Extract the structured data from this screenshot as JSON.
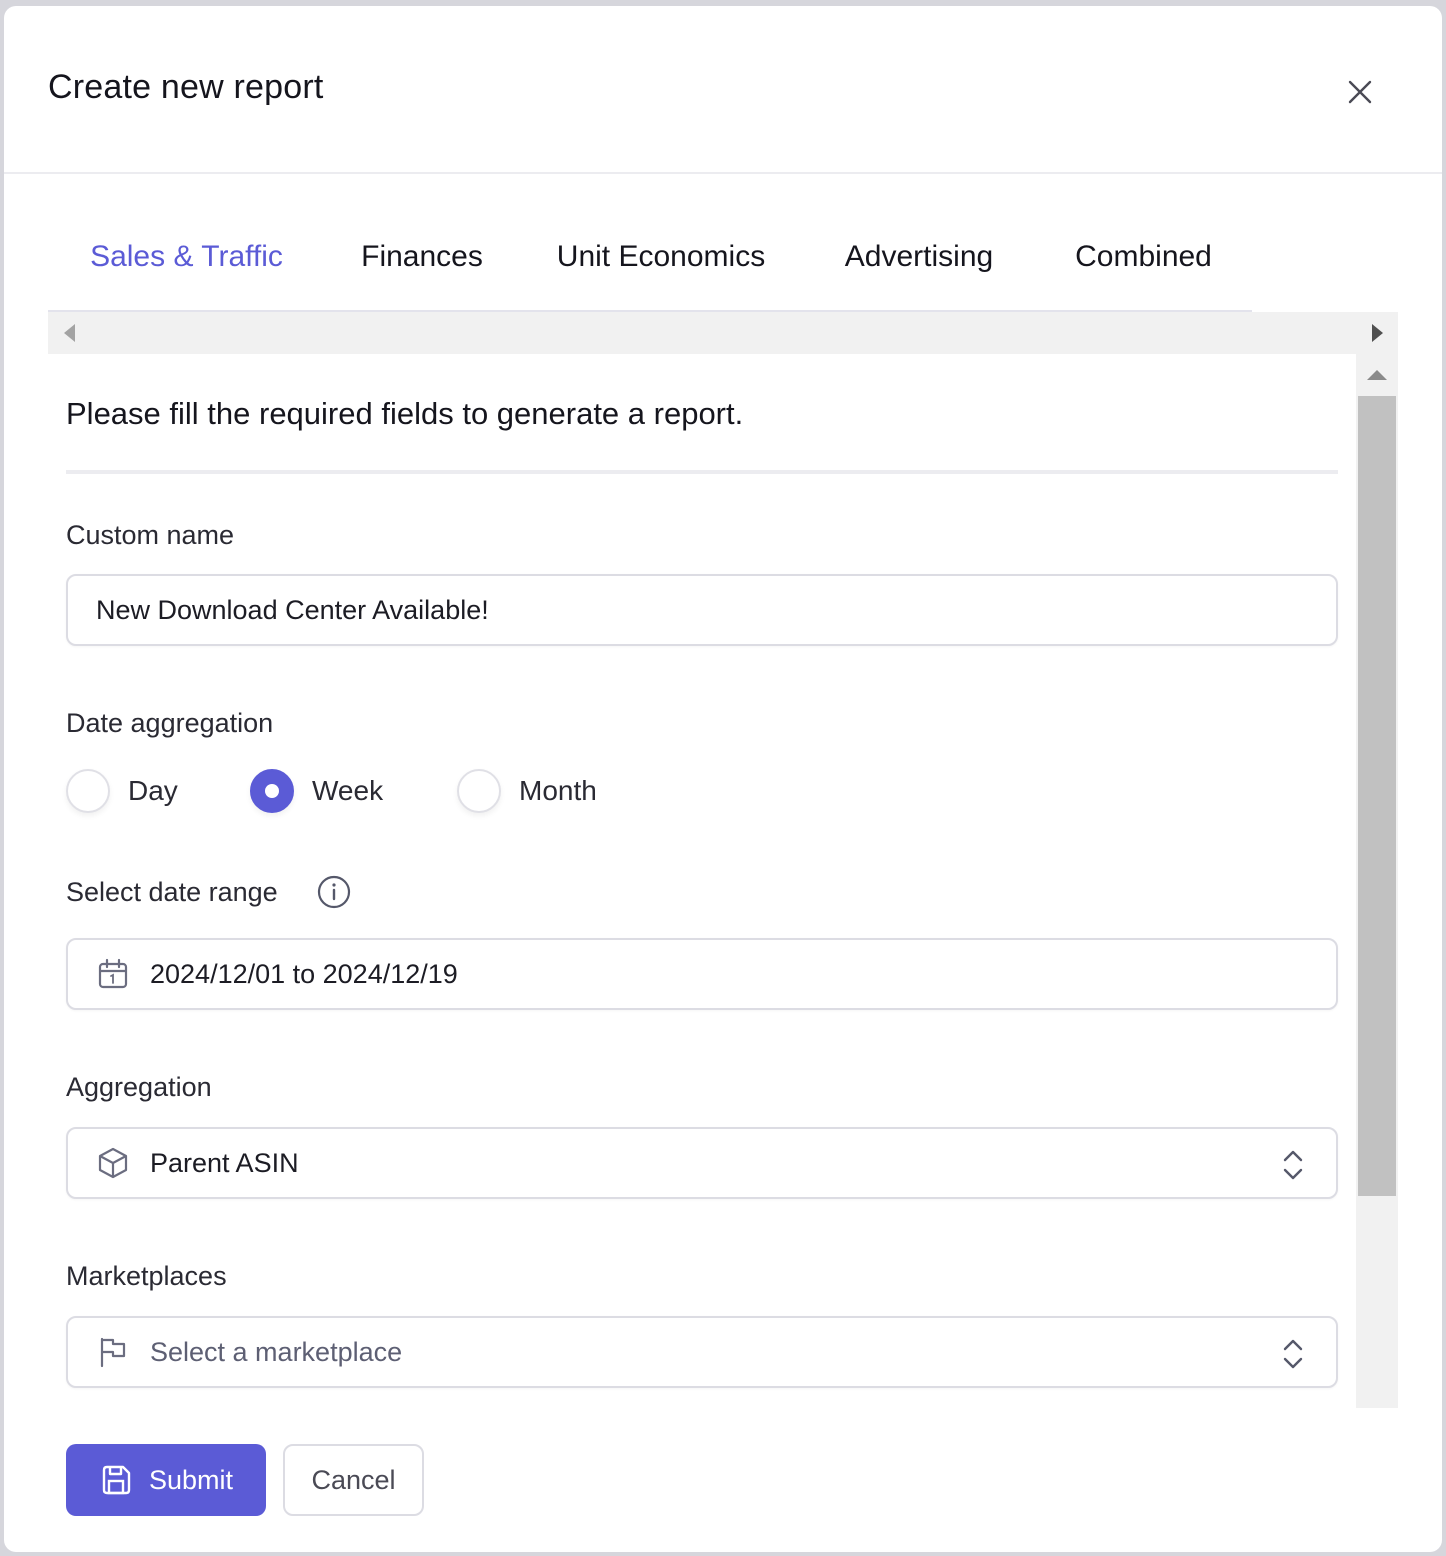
{
  "modal": {
    "title": "Create new report",
    "close_icon": "close-icon"
  },
  "tabs": [
    {
      "label": "Sales & Traffic",
      "active": true
    },
    {
      "label": "Finances",
      "active": false
    },
    {
      "label": "Unit Economics",
      "active": false
    },
    {
      "label": "Advertising",
      "active": false
    },
    {
      "label": "Combined",
      "active": false
    }
  ],
  "form": {
    "intro": "Please fill the required fields to generate a report.",
    "custom_name": {
      "label": "Custom name",
      "value": "New Download Center Available!"
    },
    "date_aggregation": {
      "label": "Date aggregation",
      "options": [
        "Day",
        "Week",
        "Month"
      ],
      "selected": "Week"
    },
    "date_range": {
      "label": "Select date range",
      "value": "2024/12/01 to 2024/12/19",
      "icon": "calendar-icon",
      "info_icon": "info-icon"
    },
    "aggregation": {
      "label": "Aggregation",
      "value": "Parent ASIN",
      "icon": "box-icon"
    },
    "marketplaces": {
      "label": "Marketplaces",
      "placeholder": "Select a marketplace",
      "icon": "flag-icon"
    }
  },
  "footer": {
    "submit_label": "Submit",
    "cancel_label": "Cancel"
  },
  "colors": {
    "accent": "#5b5bd6",
    "text": "#15151d",
    "border": "#dcdce3"
  }
}
